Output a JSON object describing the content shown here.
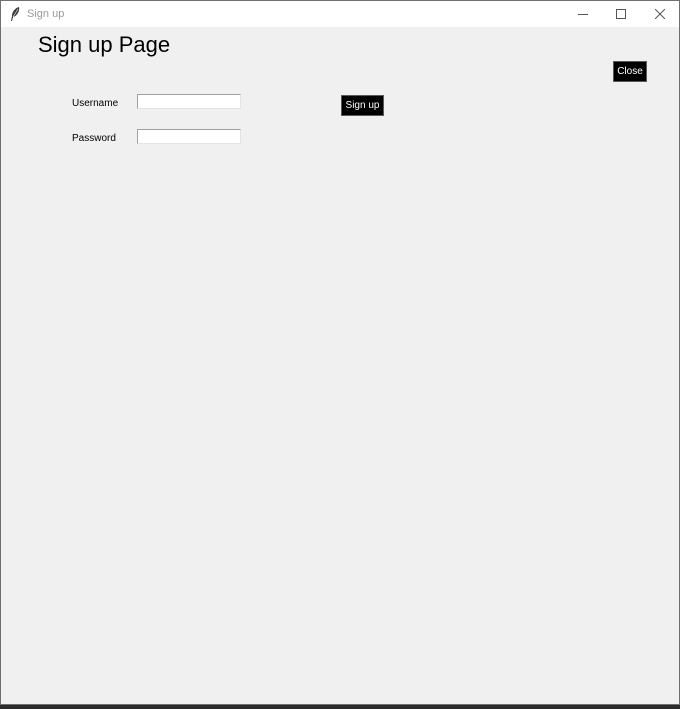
{
  "window": {
    "title": "Sign up",
    "icons": {
      "app": "feather-icon",
      "minimize": "minimize-icon",
      "maximize": "maximize-icon",
      "close": "close-icon"
    }
  },
  "page": {
    "heading": "Sign up Page"
  },
  "form": {
    "username": {
      "label": "Username",
      "value": ""
    },
    "password": {
      "label": "Password",
      "value": ""
    },
    "submit_label": "Sign up"
  },
  "close_button_label": "Close",
  "colors": {
    "button_background": "#000000",
    "button_text": "#ffffff",
    "window_background": "#f0f0f0"
  }
}
